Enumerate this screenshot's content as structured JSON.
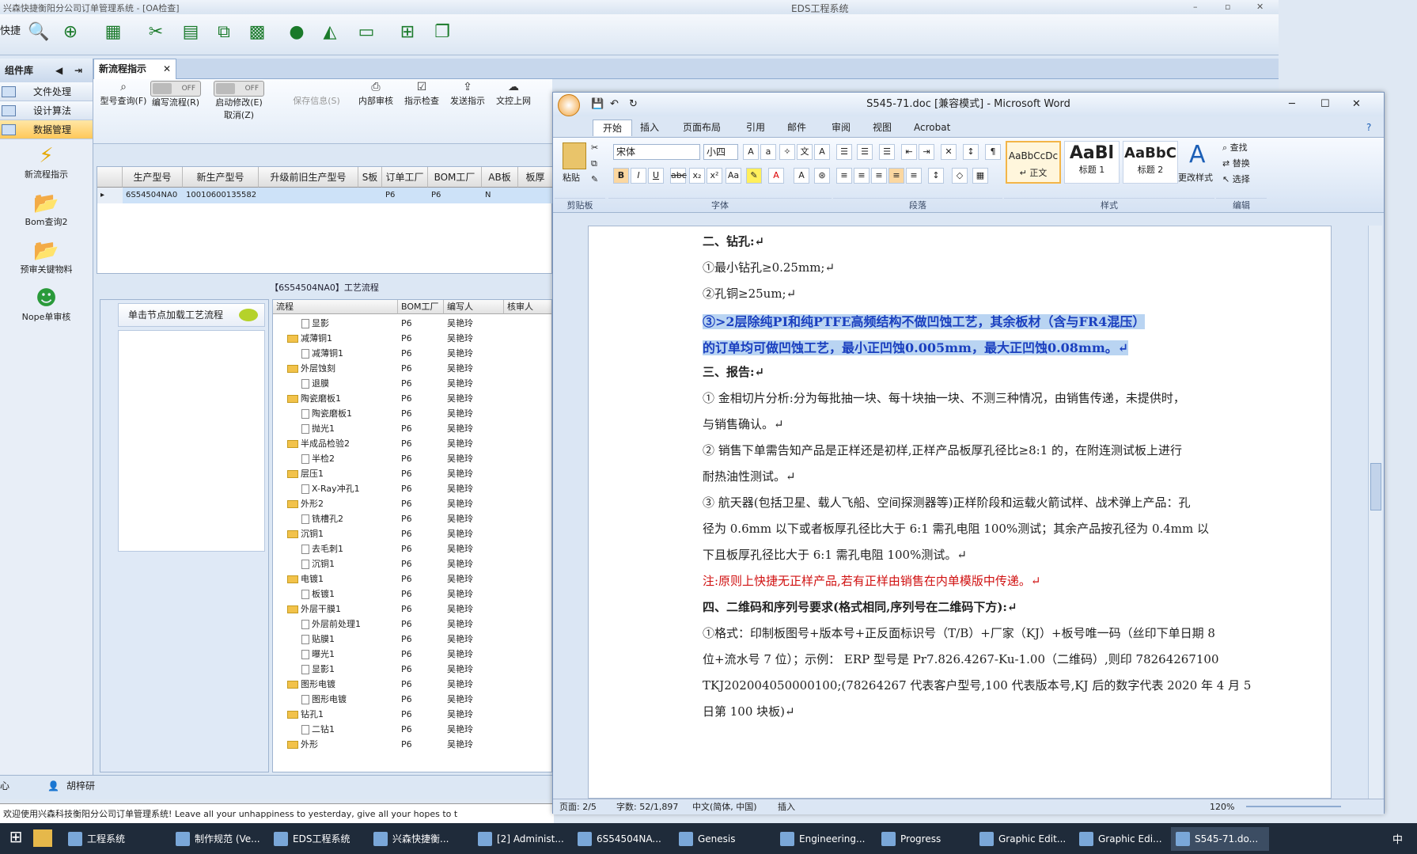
{
  "app": {
    "title": "兴森快捷衡阳分公司订单管理系统 - [OA检查]",
    "eds_title": "EDS工程系统",
    "quick_label": "快捷"
  },
  "sidebar": {
    "header": "组件库",
    "categories": [
      "文件处理",
      "设计算法",
      "数据管理"
    ],
    "items": [
      "新流程指示",
      "Bom查询2",
      "预审关键物料",
      "Nope单审核"
    ]
  },
  "tab": {
    "label": "新流程指示"
  },
  "ribbon": {
    "buttons": [
      "型号查询(F)",
      "编写流程(R)",
      "启动修改(E)\n取消(Z)",
      "保存信息(S)",
      "内部审核",
      "指示检查",
      "发送指示",
      "文控上网"
    ],
    "toggle_label": "OFF"
  },
  "grid": {
    "headers": [
      "生产型号",
      "新生产型号",
      "升级前旧生产型号",
      "S板",
      "订单工厂",
      "BOM工厂",
      "AB板",
      "板厚"
    ],
    "row": [
      "6S54504NA0",
      "10010600135582",
      "",
      "",
      "P6",
      "P6",
      "N",
      ""
    ]
  },
  "flow": {
    "title": "【6S54504NA0】工艺流程",
    "hint": "单击节点加载工艺流程",
    "headers": [
      "流程",
      "BOM工厂",
      "编写人",
      "核审人"
    ],
    "rows": [
      {
        "name": "显影",
        "lvl": 2,
        "bom": "P6",
        "by": "吴艳玲"
      },
      {
        "name": "减薄铜1",
        "lvl": 1,
        "bom": "P6",
        "by": "吴艳玲"
      },
      {
        "name": "减薄铜1",
        "lvl": 2,
        "bom": "P6",
        "by": "吴艳玲"
      },
      {
        "name": "外层蚀刻",
        "lvl": 1,
        "bom": "P6",
        "by": "吴艳玲"
      },
      {
        "name": "退膜",
        "lvl": 2,
        "bom": "P6",
        "by": "吴艳玲"
      },
      {
        "name": "陶瓷磨板1",
        "lvl": 1,
        "bom": "P6",
        "by": "吴艳玲"
      },
      {
        "name": "陶瓷磨板1",
        "lvl": 2,
        "bom": "P6",
        "by": "吴艳玲"
      },
      {
        "name": "抛光1",
        "lvl": 2,
        "bom": "P6",
        "by": "吴艳玲"
      },
      {
        "name": "半成品检验2",
        "lvl": 1,
        "bom": "P6",
        "by": "吴艳玲"
      },
      {
        "name": "半检2",
        "lvl": 2,
        "bom": "P6",
        "by": "吴艳玲"
      },
      {
        "name": "层压1",
        "lvl": 1,
        "bom": "P6",
        "by": "吴艳玲"
      },
      {
        "name": "X-Ray冲孔1",
        "lvl": 2,
        "bom": "P6",
        "by": "吴艳玲"
      },
      {
        "name": "外形2",
        "lvl": 1,
        "bom": "P6",
        "by": "吴艳玲"
      },
      {
        "name": "铣槽孔2",
        "lvl": 2,
        "bom": "P6",
        "by": "吴艳玲"
      },
      {
        "name": "沉铜1",
        "lvl": 1,
        "bom": "P6",
        "by": "吴艳玲"
      },
      {
        "name": "去毛刺1",
        "lvl": 2,
        "bom": "P6",
        "by": "吴艳玲"
      },
      {
        "name": "沉铜1",
        "lvl": 2,
        "bom": "P6",
        "by": "吴艳玲"
      },
      {
        "name": "电镀1",
        "lvl": 1,
        "bom": "P6",
        "by": "吴艳玲"
      },
      {
        "name": "板镀1",
        "lvl": 2,
        "bom": "P6",
        "by": "吴艳玲"
      },
      {
        "name": "外层干膜1",
        "lvl": 1,
        "bom": "P6",
        "by": "吴艳玲"
      },
      {
        "name": "外层前处理1",
        "lvl": 2,
        "bom": "P6",
        "by": "吴艳玲"
      },
      {
        "name": "贴膜1",
        "lvl": 2,
        "bom": "P6",
        "by": "吴艳玲"
      },
      {
        "name": "曝光1",
        "lvl": 2,
        "bom": "P6",
        "by": "吴艳玲"
      },
      {
        "name": "显影1",
        "lvl": 2,
        "bom": "P6",
        "by": "吴艳玲"
      },
      {
        "name": "图形电镀",
        "lvl": 1,
        "bom": "P6",
        "by": "吴艳玲"
      },
      {
        "name": "图形电镀",
        "lvl": 2,
        "bom": "P6",
        "by": "吴艳玲"
      },
      {
        "name": "钻孔1",
        "lvl": 1,
        "bom": "P6",
        "by": "吴艳玲"
      },
      {
        "name": "二钻1",
        "lvl": 2,
        "bom": "P6",
        "by": "吴艳玲"
      },
      {
        "name": "外形",
        "lvl": 1,
        "bom": "P6",
        "by": "吴艳玲"
      }
    ]
  },
  "status": {
    "left": "心",
    "user": "胡梓研"
  },
  "message": "欢迎使用兴森科技衡阳分公司订单管理系统!      Leave all your unhappiness to yesterday, give all your hopes to t",
  "word": {
    "title": "S545-71.doc [兼容模式] - Microsoft Word",
    "tabs": [
      "开始",
      "插入",
      "页面布局",
      "引用",
      "邮件",
      "审阅",
      "视图",
      "Acrobat"
    ],
    "font": "宋体",
    "size": "小四",
    "groups": [
      "剪贴板",
      "字体",
      "段落",
      "样式",
      "编辑"
    ],
    "styles": [
      {
        "preview": "AaBbCcDc",
        "name": "↵ 正文"
      },
      {
        "preview": "AaBl",
        "name": "标题 1"
      },
      {
        "preview": "AaBbC",
        "name": "标题 2"
      }
    ],
    "change_styles": "更改样式",
    "edit": [
      "查找",
      "替换",
      "选择"
    ],
    "paste": "粘贴",
    "status": {
      "page": "页面: 2/5",
      "words": "字数: 52/1,897",
      "lang": "中文(简体, 中国)",
      "mode": "插入",
      "zoom": "120%"
    },
    "lines": [
      "二、钻孔:↵",
      "①最小钻孔≥0.25mm;↵",
      "②孔铜≥25um;↵",
      "③>2层除纯PI和纯PTFE高频结构不做凹蚀工艺，其余板材（含与FR4混压）",
      "的订单均可做凹蚀工艺，最小正凹蚀0.005mm，最大正凹蚀0.08mm。↵",
      "三、报告:↵",
      "①  金相切片分析:分为每批抽一块、每十块抽一块、不测三种情况，由销售传递，未提供时，",
      "与销售确认。↵",
      "②  销售下单需告知产品是正样还是初样,正样产品板厚孔径比≥8:1 的，在附连测试板上进行",
      "耐热油性测试。↵",
      "③  航天器(包括卫星、载人飞船、空间探测器等)正样阶段和运载火箭试样、战术弹上产品：孔",
      "径为 0.6mm 以下或者板厚孔径比大于 6:1 需孔电阻 100%测试；其余产品按孔径为 0.4mm 以",
      "下且板厚孔径比大于 6:1 需孔电阻 100%测试。↵",
      "注:原则上快捷无正样产品,若有正样由销售在内单模版中传递。↵",
      "四、二维码和序列号要求(格式相同,序列号在二维码下方):↵",
      "①格式：印制板图号+版本号+正反面标识号（T/B）+厂家（KJ）+板号唯一码（丝印下单日期 8",
      "位+流水号 7 位）；示例： ERP 型号是 Pr7.826.4267-Ku-1.00（二维码）,则印 78264267100",
      "TKJ202004050000100;(78264267 代表客户型号,100 代表版本号,KJ 后的数字代表 2020 年 4 月 5",
      "日第 100 块板)↵"
    ]
  },
  "taskbar": [
    "工程系统",
    "制作规范 (Ve...",
    "EDS工程系统",
    "兴森快捷衡...",
    "[2] Administ...",
    "6S54504NA...",
    "Genesis",
    "Engineering...",
    "Progress",
    "Graphic Edit...",
    "Graphic Edi...",
    "S545-71.do..."
  ],
  "tray": {
    "ime": "中"
  }
}
